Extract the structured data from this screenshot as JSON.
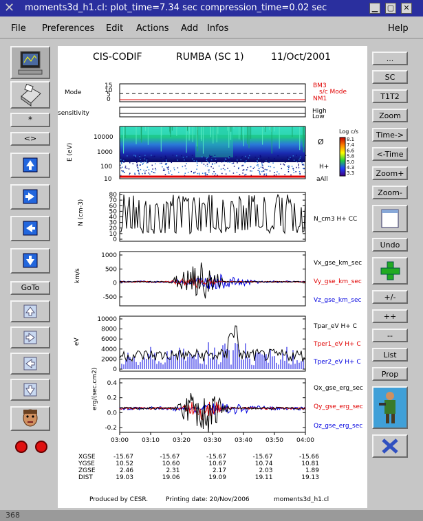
{
  "window": {
    "title": "moments3d_h1.cl: plot_time=7.34 sec  compression_time=0.02 sec"
  },
  "menu": [
    "File",
    "Preferences",
    "Edit",
    "Actions",
    "Add",
    "Infos",
    "Help"
  ],
  "left_toolbar": {
    "star_label": "*",
    "diamond_label": "<>",
    "goto_label": "GoTo"
  },
  "right_toolbar": [
    "...",
    "SC",
    "T1T2",
    "Zoom",
    "Time->",
    "<-Time",
    "Zoom+",
    "Zoom-",
    "Undo",
    "+/-",
    "++",
    "--",
    "List",
    "Prop"
  ],
  "header": {
    "instrument": "CIS-CODIF",
    "mission": "RUMBA (SC 1)",
    "date": "11/Oct/2001"
  },
  "panels": {
    "mode": {
      "ylabel": "Mode",
      "ticks": [
        "15",
        "10",
        "5",
        "0"
      ],
      "labels": [
        "BM3",
        "s/c Mode",
        "NM1"
      ]
    },
    "sensitivity": {
      "ylabel": "sensitivity",
      "labels": [
        "High",
        "Low"
      ]
    },
    "spectrogram": {
      "ylabel": "E (eV)",
      "ticks": [
        "10000",
        "1000",
        "100",
        "10"
      ],
      "colorbar_title": "Log c/s",
      "colorbar_ticks": [
        "8.1",
        "7.4",
        "6.6",
        "5.8",
        "5.0",
        "4.3",
        "3.3"
      ],
      "labels": [
        "H+",
        "aAll"
      ]
    },
    "density": {
      "ylabel": "N (cm-3)",
      "ticks": [
        "80",
        "70",
        "60",
        "50",
        "40",
        "30",
        "20",
        "10",
        "0"
      ],
      "label": "N_cm3  H+ CC"
    },
    "velocity": {
      "ylabel": "km/s",
      "ticks": [
        "1000",
        "500",
        "0",
        "-500"
      ],
      "labels": [
        "Vx_gse_km_sec",
        "Vy_gse_km_sec",
        "Vz_gse_km_sec"
      ]
    },
    "temperature": {
      "ylabel": "eV",
      "ticks": [
        "10000",
        "8000",
        "6000",
        "4000",
        "2000",
        "0"
      ],
      "labels": [
        "Tpar_eV  H+ C",
        "Tper1_eV  H+ C",
        "Tper2_eV  H+ C"
      ]
    },
    "heatflux": {
      "ylabel": "erg/(sec.cm2)",
      "ticks": [
        "0.4",
        "0.2",
        "0.0",
        "-0.2"
      ],
      "labels": [
        "Qx_gse_erg_sec",
        "Qy_gse_erg_sec",
        "Qz_gse_erg_sec"
      ]
    }
  },
  "time_ticks": [
    "03:00",
    "03:10",
    "03:20",
    "03:30",
    "03:40",
    "03:50",
    "04:00"
  ],
  "ephemeris": {
    "rows": [
      {
        "name": "XGSE",
        "values": [
          "-15.67",
          "-15.67",
          "-15.67",
          "-15.67",
          "-15.66"
        ]
      },
      {
        "name": "YGSE",
        "values": [
          "10.52",
          "10.60",
          "10.67",
          "10.74",
          "10.81"
        ]
      },
      {
        "name": "ZGSE",
        "values": [
          "2.46",
          "2.31",
          "2.17",
          "2.03",
          "1.89"
        ]
      },
      {
        "name": "DIST",
        "values": [
          "19.03",
          "19.06",
          "19.09",
          "19.11",
          "19.13"
        ]
      }
    ]
  },
  "footer": {
    "produced": "Produced by CESR.",
    "printing": "Printing date: 20/Nov/2006",
    "file": "moments3d_h1.cl"
  },
  "colors": {
    "titlebar": "#2a2f9e",
    "red": "#e00000",
    "blue": "#0000e0",
    "black": "#000000"
  },
  "corner_text": "368"
}
